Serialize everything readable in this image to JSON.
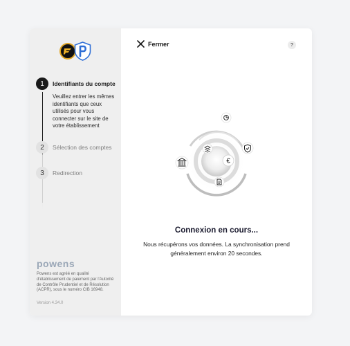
{
  "sidebar": {
    "logos": [
      "partner-logo",
      "powens-shield-logo"
    ],
    "steps": [
      {
        "number": "1",
        "label": "Identifiants du compte",
        "state": "active",
        "description": "Veuillez entrer les mêmes identifiants que ceux utilisés pour vous connecter sur le site de votre établissement"
      },
      {
        "number": "2",
        "label": "Sélection des comptes",
        "state": "inactive"
      },
      {
        "number": "3",
        "label": "Redirection",
        "state": "inactive"
      }
    ],
    "brand": "powens",
    "legal": "Powens est agréé en qualité d'établissement de paiement par l'Autorité de Contrôle Prudentiel et de Résolution (ACPR), sous le numéro CIB 16948.",
    "version": "Version 4.34.0"
  },
  "header": {
    "close_label": "Fermer",
    "help_label": "?"
  },
  "main": {
    "title": "Connexion en cours...",
    "subtitle": "Nous récupérons vos données. La synchronisation prend généralement environ 20 secondes.",
    "icons": [
      "bank-icon",
      "layers-icon",
      "pie-chart-icon",
      "shield-check-icon",
      "euro-icon",
      "document-icon"
    ]
  },
  "colors": {
    "sidebar_bg": "#efefef",
    "active_step": "#1a1a1a",
    "brand_text": "#9aa7b7",
    "page_bg": "#f3f4f6"
  }
}
